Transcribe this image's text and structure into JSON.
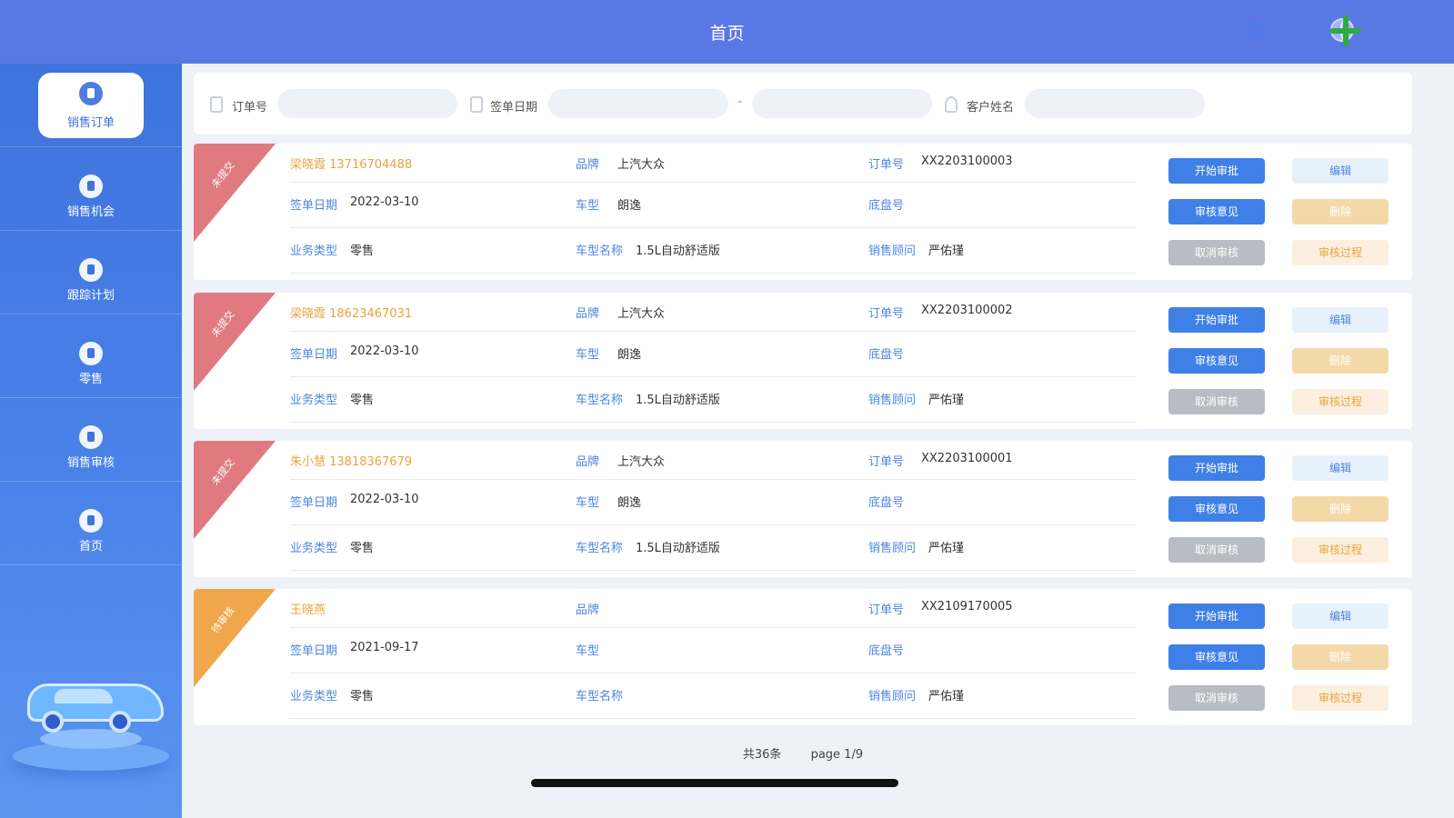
{
  "header": {
    "title": "首页"
  },
  "sidebar": {
    "items": [
      {
        "label": "销售订单",
        "icon": "order-icon",
        "active": true
      },
      {
        "label": "销售机会",
        "icon": "location-pin-icon"
      },
      {
        "label": "跟踪计划",
        "icon": "clock-icon"
      },
      {
        "label": "零售",
        "icon": "flame-icon"
      },
      {
        "label": "销售审核",
        "icon": "document-icon"
      },
      {
        "label": "首页",
        "icon": "home-icon"
      }
    ]
  },
  "search": {
    "order_label": "订单号",
    "order_placeholder": "",
    "date_label": "签单日期",
    "date_from_placeholder": "",
    "date_separator": "-",
    "date_to_placeholder": "",
    "customer_label": "客户姓名",
    "customer_placeholder": ""
  },
  "labels": {
    "brand": "品牌",
    "order_no": "订单号",
    "sign_date": "签单日期",
    "model": "车型",
    "vin": "底盘号",
    "business_type": "业务类型",
    "model_name": "车型名称",
    "consultant": "销售顾问"
  },
  "buttons": {
    "start_review": "开始审批",
    "review_opinion": "审核意见",
    "cancel_review": "取消审核",
    "edit": "编辑",
    "delete": "删除",
    "review_process": "审核过程"
  },
  "colors": {
    "red_ribbon": "#e07a80",
    "orange_ribbon": "#f0a64a",
    "primary": "#3f80e6",
    "header": "#5a78e4"
  },
  "orders": [
    {
      "status": "未提交",
      "ribbon_color": "red",
      "customer": "梁晓霞 13716704488",
      "brand": "上汽大众",
      "order_no": "XX2203100003",
      "sign_date": "2022-03-10",
      "model": "朗逸",
      "vin": "",
      "business_type": "零售",
      "model_name": "1.5L自动舒适版",
      "consultant": "严佑瑾"
    },
    {
      "status": "未提交",
      "ribbon_color": "red",
      "customer": "梁晓霞 18623467031",
      "brand": "上汽大众",
      "order_no": "XX2203100002",
      "sign_date": "2022-03-10",
      "model": "朗逸",
      "vin": "",
      "business_type": "零售",
      "model_name": "1.5L自动舒适版",
      "consultant": "严佑瑾"
    },
    {
      "status": "未提交",
      "ribbon_color": "red",
      "customer": "朱小慧 13818367679",
      "brand": "上汽大众",
      "order_no": "XX2203100001",
      "sign_date": "2022-03-10",
      "model": "朗逸",
      "vin": "",
      "business_type": "零售",
      "model_name": "1.5L自动舒适版",
      "consultant": "严佑瑾"
    },
    {
      "status": "待审核",
      "ribbon_color": "orange",
      "customer": "王晓燕",
      "brand": "",
      "order_no": "XX2109170005",
      "sign_date": "2021-09-17",
      "model": "",
      "vin": "",
      "business_type": "零售",
      "model_name": "",
      "consultant": "严佑瑾"
    }
  ],
  "pager": {
    "total": "共36条",
    "page": "page 1/9"
  }
}
